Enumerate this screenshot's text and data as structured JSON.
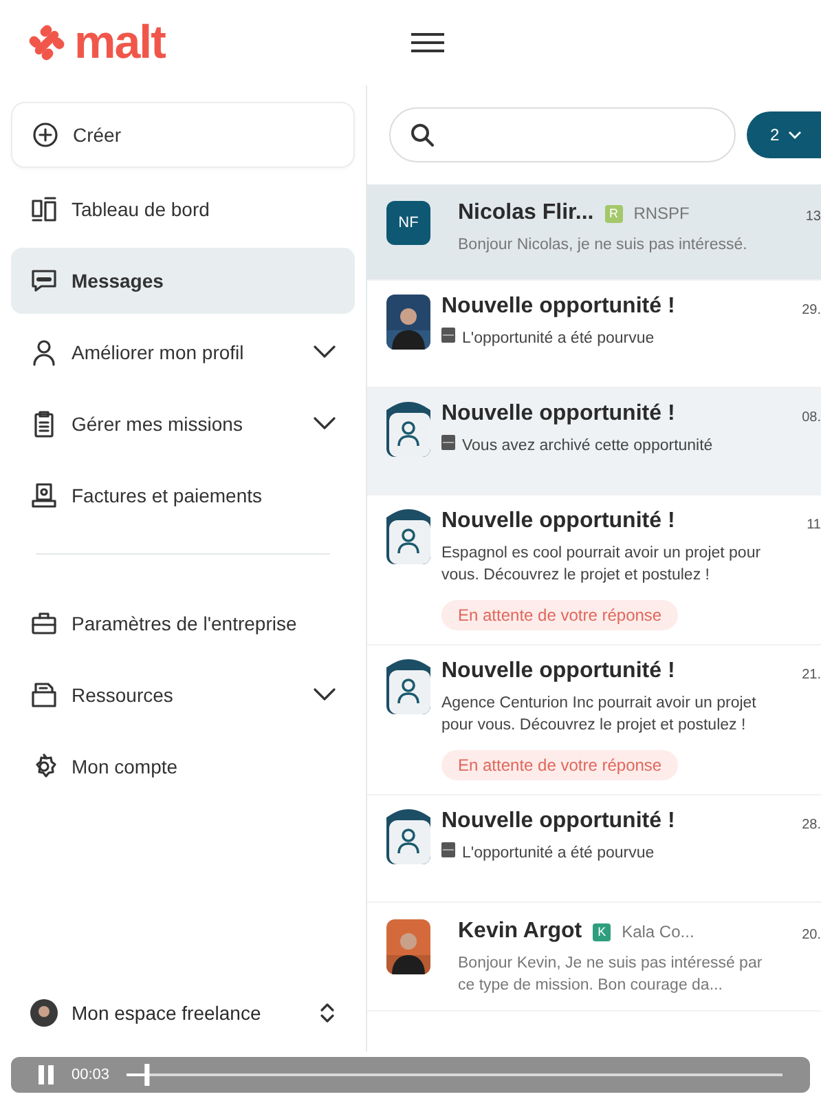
{
  "logo": {
    "text": "malt"
  },
  "sidebar": {
    "create": {
      "label": "Créer"
    },
    "main_items": [
      {
        "label": "Tableau de bord",
        "selected": false,
        "expandable": false
      },
      {
        "label": "Messages",
        "selected": true,
        "expandable": false
      },
      {
        "label": "Améliorer mon profil",
        "selected": false,
        "expandable": true
      },
      {
        "label": "Gérer mes missions",
        "selected": false,
        "expandable": true
      },
      {
        "label": "Factures et paiements",
        "selected": false,
        "expandable": false
      }
    ],
    "settings_items": [
      {
        "label": "Paramètres de l'entreprise",
        "selected": false,
        "expandable": false
      },
      {
        "label": "Ressources",
        "selected": false,
        "expandable": true
      },
      {
        "label": "Mon compte",
        "selected": false,
        "expandable": false
      }
    ],
    "workspace": {
      "label": "Mon espace freelance"
    }
  },
  "search": {
    "filter_count": "2"
  },
  "messages": [
    {
      "kind": "contact",
      "avatar": {
        "kind": "initials",
        "text": "NF"
      },
      "title": "Nicolas Flir...",
      "tag": {
        "text": "R",
        "color": "#a3c86b"
      },
      "company": "RNSPF",
      "preview": "Bonjour Nicolas, je ne suis pas intéressé.",
      "date": "13",
      "selected": true,
      "hovered": false,
      "archived": false
    },
    {
      "kind": "opportunity",
      "title": "Nouvelle opportunité !",
      "preview": "L'opportunité a été pourvue",
      "date": "29.",
      "selected": false,
      "hovered": false,
      "archived": true
    },
    {
      "kind": "opportunity",
      "avatar": {
        "kind": "placeholder"
      },
      "title": "Nouvelle opportunité !",
      "preview": "Vous avez archivé cette opportunité",
      "date": "08.",
      "selected": false,
      "hovered": true,
      "archived": true
    },
    {
      "kind": "opportunity",
      "avatar": {
        "kind": "placeholder"
      },
      "title": "Nouvelle opportunité !",
      "preview": "Espagnol es cool pourrait avoir un projet pour vous. Découvrez le projet et postulez !",
      "status": "En attente de votre réponse",
      "date": "11",
      "selected": false,
      "hovered": false,
      "archived": false
    },
    {
      "kind": "opportunity",
      "avatar": {
        "kind": "placeholder"
      },
      "title": "Nouvelle opportunité !",
      "preview": "Agence Centurion Inc pourrait avoir un projet pour vous. Découvrez le projet et postulez !",
      "status": "En attente de votre réponse",
      "date": "21.",
      "selected": false,
      "hovered": false,
      "archived": false
    },
    {
      "kind": "opportunity",
      "avatar": {
        "kind": "placeholder"
      },
      "title": "Nouvelle opportunité !",
      "preview": "L'opportunité a été pourvue",
      "date": "28.",
      "selected": false,
      "hovered": false,
      "archived": true
    },
    {
      "kind": "contact",
      "title": "Kevin Argot",
      "tag": {
        "text": "K",
        "color": "#2e9e7e"
      },
      "company": "Kala Co...",
      "preview": "Bonjour Kevin, Je ne suis pas intéressé par ce type de mission. Bon courage da...",
      "date": "20.",
      "selected": false,
      "hovered": false,
      "archived": false
    }
  ],
  "player": {
    "playing": true,
    "time": "00:03"
  }
}
